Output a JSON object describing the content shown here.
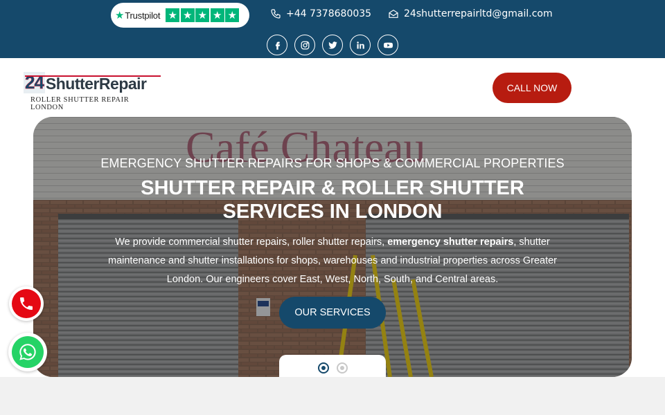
{
  "topbar": {
    "trustpilot": {
      "label": "Trustpilot",
      "stars": 5
    },
    "phone": "+44 7378680035",
    "email": "24shutterrepairltd@gmail.com",
    "socials": [
      {
        "icon": "facebook-icon"
      },
      {
        "icon": "instagram-icon"
      },
      {
        "icon": "twitter-icon"
      },
      {
        "icon": "linkedin-icon"
      },
      {
        "icon": "youtube-icon"
      }
    ]
  },
  "header": {
    "logo": {
      "number": "24",
      "word": "ShutterRepair",
      "subtitle": "ROLLER SHUTTER REPAIR LONDON"
    },
    "call_now": "CALL NOW"
  },
  "hero": {
    "subtitle": "EMERGENCY SHUTTER REPAIRS FOR SHOPS & COMMERCIAL PROPERTIES",
    "title": "SHUTTER REPAIR & ROLLER SHUTTER SERVICES IN LONDON",
    "description_before": "We provide commercial shutter repairs, roller shutter repairs, ",
    "description_bold": "emergency shutter repairs",
    "description_after": ", shutter maintenance and shutter installations for shops, warehouses and industrial properties across Greater London. Our engineers cover East, West, North, South, and Central areas.",
    "button": "OUR SERVICES",
    "background_sign": "Café Chateau",
    "slide_count": 2,
    "active_slide": 1
  },
  "colors": {
    "primary": "#15496b",
    "call_now": "#b71c10",
    "trustpilot_green": "#00b67a",
    "whatsapp": "#25d366",
    "phone_float": "#e50914"
  }
}
